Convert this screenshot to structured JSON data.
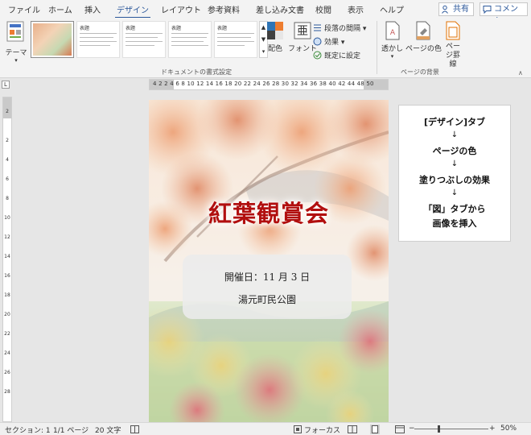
{
  "tabs": [
    {
      "label": "ファイル"
    },
    {
      "label": "ホーム"
    },
    {
      "label": "挿入"
    },
    {
      "label": "デザイン"
    },
    {
      "label": "レイアウト"
    },
    {
      "label": "参考資料"
    },
    {
      "label": "差し込み文書"
    },
    {
      "label": "校閲"
    },
    {
      "label": "表示"
    },
    {
      "label": "ヘルプ"
    }
  ],
  "active_tab": "デザイン",
  "share_label": "共有",
  "comment_label": "コメント",
  "ribbon": {
    "theme_label": "テーマ",
    "style_gallery": [
      {
        "title": ""
      },
      {
        "title": "表題"
      },
      {
        "title": "表題"
      },
      {
        "title": "表題"
      },
      {
        "title": "表題"
      }
    ],
    "colors_label": "配色",
    "fonts_label": "フォント",
    "paragraph_spacing_label": "段落の間隔",
    "effects_label": "効果",
    "set_default_label": "既定に設定",
    "watermark_label": "透かし",
    "page_color_label": "ページの色",
    "page_borders_label": "ページ罫線",
    "group_doc_format": "ドキュメントの書式設定",
    "group_page_bg": "ページの背景"
  },
  "ruler": {
    "horizontal_labels": "4  2     2  4  6  8  10 12 14 16 18 20 22 24 26 28 30 32 34 36 38 40 42 44   48 50",
    "vertical_labels": [
      "2",
      "2",
      "4",
      "6",
      "8",
      "10",
      "12",
      "14",
      "16",
      "18",
      "20",
      "22",
      "24",
      "26",
      "28"
    ]
  },
  "document": {
    "title": "紅葉観賞会",
    "date_line": "開催日：11 月 3 日",
    "place_line": "湯元町民公園"
  },
  "callout": {
    "line1": "[デザイン]タブ",
    "arrow": "↓",
    "line2": "ページの色",
    "line3": "塗りつぶしの効果",
    "line4": "「図」タブから",
    "line5": "画像を挿入"
  },
  "status": {
    "section": "セクション: 1",
    "page": "1/1 ページ",
    "words": "20 文字",
    "focus": "フォーカス",
    "zoom_minus": "−",
    "zoom_plus": "+",
    "zoom": "50%"
  },
  "colors": {
    "accent": "#2b579a",
    "title_red": "#b10f0f"
  }
}
